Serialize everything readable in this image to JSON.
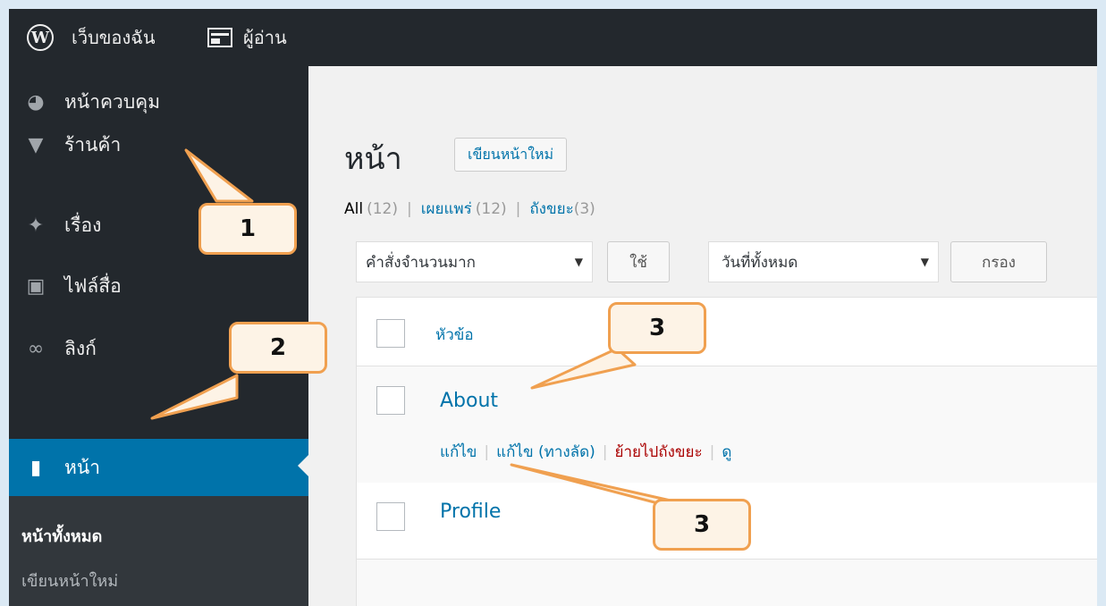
{
  "adminbar": {
    "site_name": "เว็บของฉัน",
    "reader_label": "ผู้อ่าน"
  },
  "sidebar": {
    "items": [
      {
        "label": "หน้าควบคุม",
        "icon": "dashboard-icon"
      },
      {
        "label": "ร้านค้า",
        "icon": "cart-icon"
      },
      {
        "label": "เรื่อง",
        "icon": "pin-icon"
      },
      {
        "label": "ไฟล์สื่อ",
        "icon": "media-icon"
      },
      {
        "label": "ลิงก์",
        "icon": "link-icon"
      },
      {
        "label": "หน้า",
        "icon": "page-icon",
        "active": true
      }
    ],
    "submenu": {
      "current": "หน้าทั้งหมด",
      "add_new": "เขียนหน้าใหม่"
    },
    "active_color": "#0073aa"
  },
  "main": {
    "title": "หน้า",
    "add_new_button": "เขียนหน้าใหม่",
    "filters": {
      "all_label": "All",
      "all_count": "(12)",
      "published_label": "เผยแพร่",
      "published_count": "(12)",
      "trash_label": "ถังขยะ",
      "trash_count": "(3)"
    },
    "bulk_action_select": "คำสั่งจำนวนมาก",
    "apply_button": "ใช้",
    "date_select": "วันที่ทั้งหมด",
    "filter_button": "กรอง",
    "table": {
      "column_title": "หัวข้อ",
      "rows": [
        {
          "title": "About",
          "actions": {
            "edit": "แก้ไข",
            "quick_edit": "แก้ไข (ทางลัด)",
            "trash": "ย้ายไปถังขยะ",
            "view": "ดู"
          }
        },
        {
          "title": "Profile"
        }
      ]
    }
  },
  "callouts": [
    {
      "label": "1"
    },
    {
      "label": "2"
    },
    {
      "label": "3"
    },
    {
      "label": "3"
    }
  ],
  "colors": {
    "callout_border": "#f0a050",
    "link": "#0073aa",
    "trash": "#a00"
  }
}
